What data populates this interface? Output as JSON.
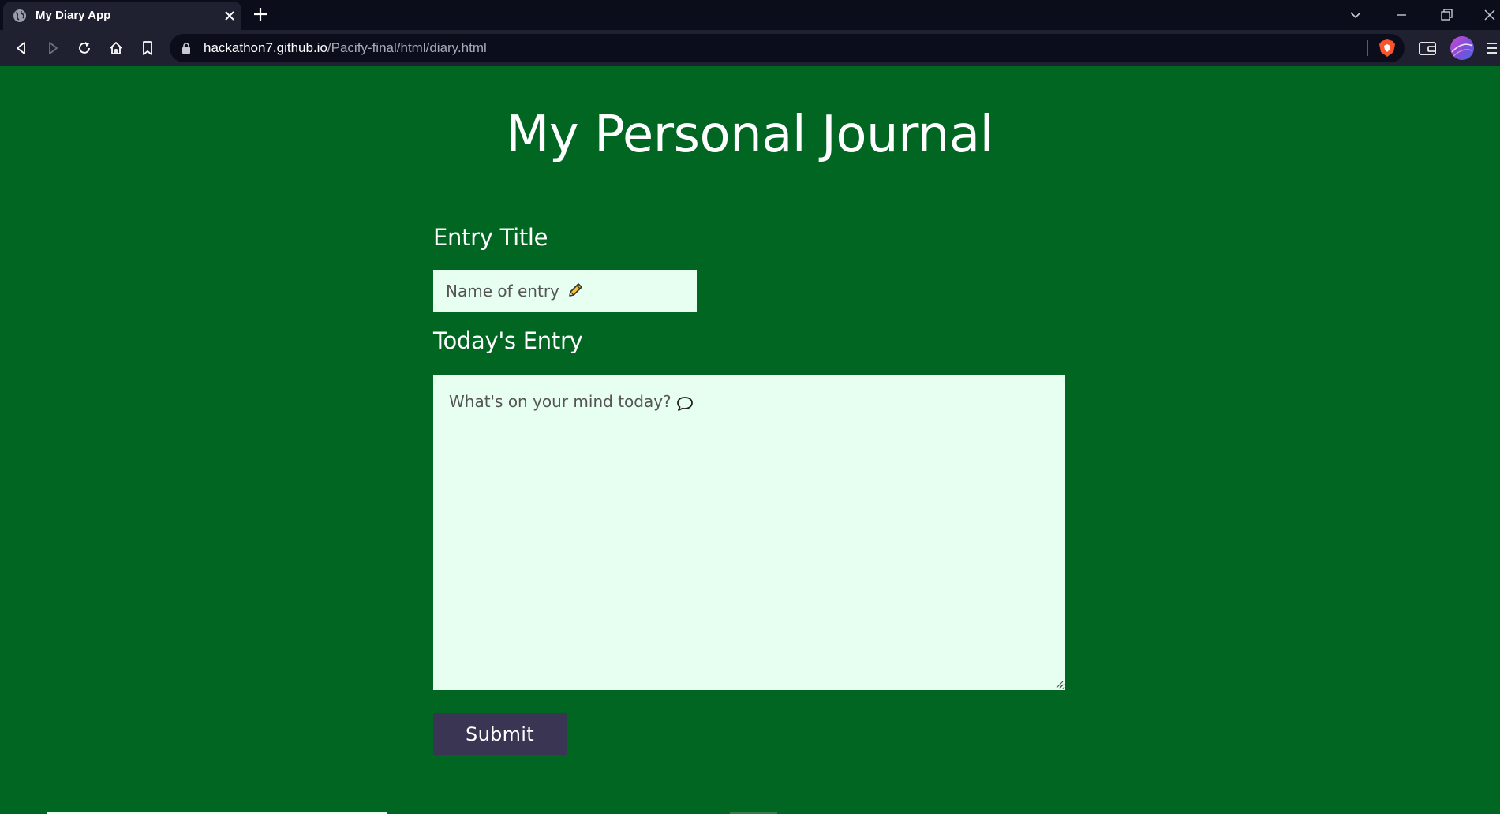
{
  "browser": {
    "tab": {
      "title": "My Diary App"
    },
    "address_bar": {
      "host": "hackathon7.github.io",
      "path": "/Pacify-final/html/diary.html"
    },
    "icons": {
      "tab_favicon": "globe-icon",
      "tab_close": "close-icon",
      "new_tab": "plus-icon",
      "back": "back-arrow-icon",
      "forward": "forward-arrow-icon",
      "reload": "reload-icon",
      "home": "home-icon",
      "bookmark": "bookmark-icon",
      "lock": "lock-icon",
      "shields": "brave-shield-icon",
      "wallet": "wallet-icon",
      "menu": "menu-icon"
    }
  },
  "page": {
    "heading": "My Personal Journal",
    "title_field": {
      "label": "Entry Title",
      "placeholder": "Name of entry",
      "icon": "pencil-icon"
    },
    "entry_field": {
      "label": "Today's Entry",
      "placeholder": "What's on your mind today?",
      "icon": "speech-bubble-icon"
    },
    "submit_label": "Submit"
  },
  "colors": {
    "page_background": "#006622",
    "field_background": "#e6fff0",
    "button_background": "#3a3553",
    "chrome_dark": "#0c0d1a",
    "chrome_toolbar": "#1f2130"
  }
}
